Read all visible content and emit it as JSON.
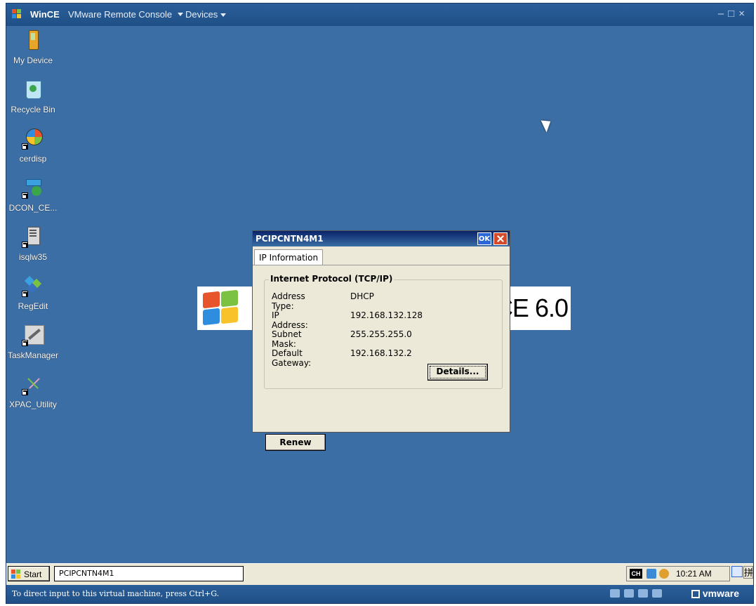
{
  "vm_window": {
    "app": "WinCE",
    "title": "VMware Remote Console",
    "devices_menu": "Devices",
    "window_controls": [
      "minimize-icon",
      "restore-icon",
      "close-icon"
    ]
  },
  "desktop": {
    "icons": [
      {
        "label": "My Device",
        "icon": "device-icon"
      },
      {
        "label": "Recycle Bin",
        "icon": "recycle-bin-icon"
      },
      {
        "label": "cerdisp",
        "icon": "globe-icon"
      },
      {
        "label": "DCON_CE...",
        "icon": "network-tool-icon"
      },
      {
        "label": "isqlw35",
        "icon": "database-icon"
      },
      {
        "label": "RegEdit",
        "icon": "registry-icon"
      },
      {
        "label": "TaskManager",
        "icon": "wrench-icon"
      },
      {
        "label": "XPAC_Utility",
        "icon": "utility-icon"
      }
    ],
    "banner_text": "CE 6.0"
  },
  "dialog": {
    "title": "PCIPCNTN4M1",
    "ok_label": "OK",
    "tab_label": "IP Information",
    "group_title": "Internet Protocol (TCP/IP)",
    "rows": [
      {
        "key": "Address Type:",
        "value": "DHCP"
      },
      {
        "key": "IP Address:",
        "value": "192.168.132.128"
      },
      {
        "key": "Subnet Mask:",
        "value": "255.255.255.0"
      },
      {
        "key": "Default Gateway:",
        "value": "192.168.132.2"
      }
    ],
    "details_label": "Details...",
    "renew_label": "Renew"
  },
  "taskbar": {
    "start_label": "Start",
    "task_button": "PCIPCNTN4M1",
    "lang": "CH",
    "clock": "10:21 AM",
    "ime_char": "拼"
  },
  "statusbar": {
    "hint": "To direct input to this virtual machine, press Ctrl+G.",
    "brand": "vmware"
  }
}
